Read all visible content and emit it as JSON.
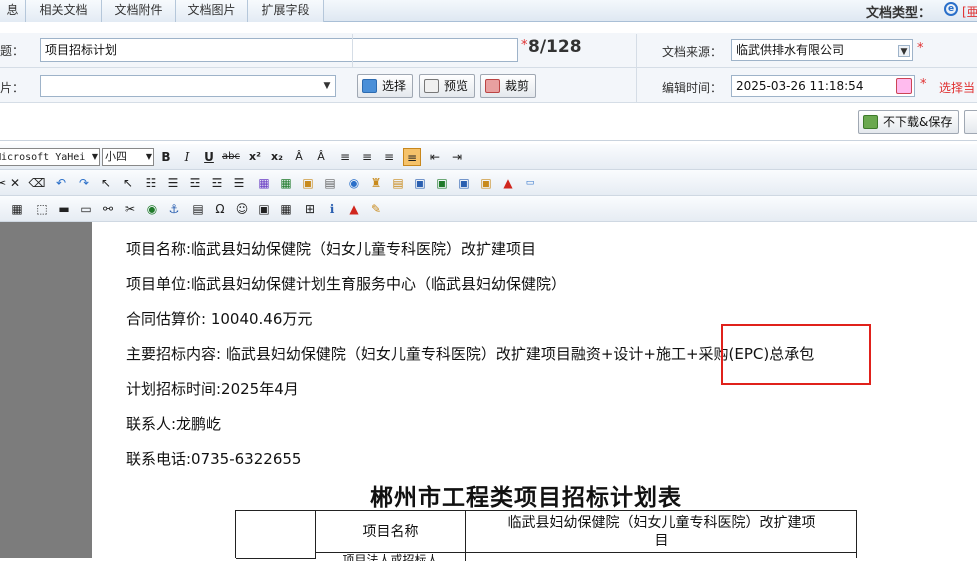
{
  "tabs": [
    "息",
    "相关文档",
    "文档附件",
    "文档图片",
    "扩展字段"
  ],
  "doc_type": {
    "label": "文档类型：",
    "trail": "[亜"
  },
  "form": {
    "title_label": "标题：",
    "title_value": "项目招标计划",
    "title_counter": "8/128",
    "image_label": "图片：",
    "image_value": "",
    "select_button": "选择",
    "preview_button": "预览",
    "crop_button": "裁剪",
    "source_label": "文档来源：",
    "source_value": "临武供排水有限公司",
    "time_label": "编辑时间：",
    "time_value": "2025-03-26 11:18:54",
    "time_note": "选择当",
    "required_mark": "*"
  },
  "save_button": "不下载&保存",
  "editor": {
    "font_family": "Microsoft YaHei",
    "font_size": "小四"
  },
  "document": {
    "lines": [
      "项目名称:临武县妇幼保健院（妇女儿童专科医院）改扩建项目",
      "项目单位:临武县妇幼保健计划生育服务中心（临武县妇幼保健院）",
      "合同估算价: 10040.46万元",
      "主要招标内容: 临武县妇幼保健院（妇女儿童专科医院）改扩建项目融资+设计+施工+采购(EPC)总承包",
      "计划招标时间:2025年4月",
      "联系人:龙鹏屹",
      "联系电话:0735-6322655"
    ],
    "table_title": "郴州市工程类项目招标计划表",
    "table_header_label": "项目名称",
    "table_header_value_line1": "临武县妇幼保健院（妇女儿童专科医院）改扩建项",
    "table_header_value_line2": "目",
    "table_next_row_label": "项目法人或招标人"
  },
  "colors": {
    "highlight_box": "#e0211b",
    "required": "#e03030"
  }
}
